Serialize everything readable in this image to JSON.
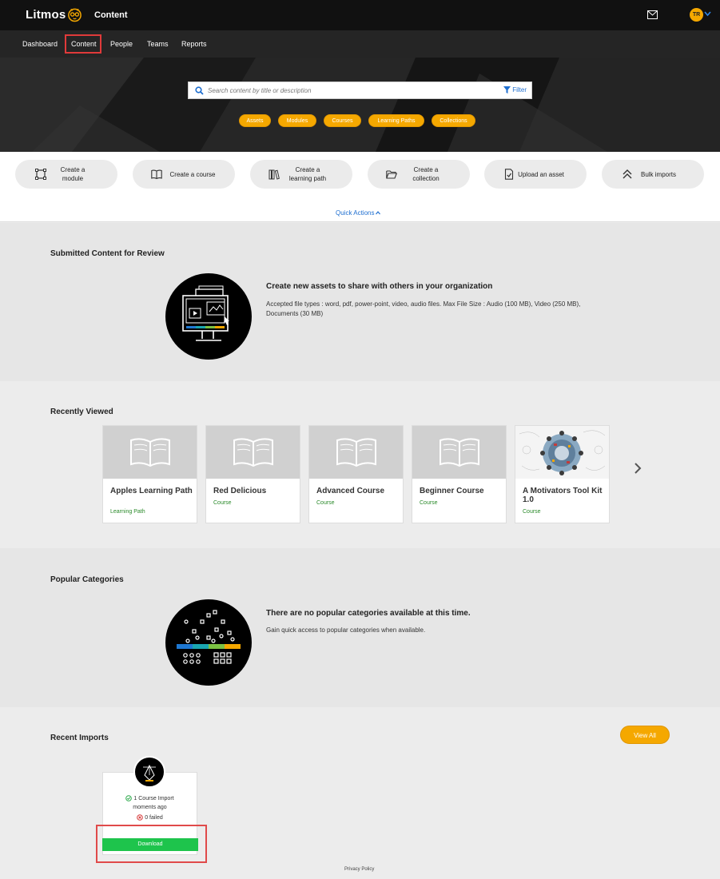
{
  "header": {
    "brand": "Litmos",
    "app_title": "Content",
    "avatar_initials": "TR",
    "accent_color": "#f5a800"
  },
  "nav": {
    "items": [
      {
        "label": "Dashboard"
      },
      {
        "label": "Content",
        "active": true
      },
      {
        "label": "People"
      },
      {
        "label": "Teams"
      },
      {
        "label": "Reports"
      }
    ]
  },
  "search": {
    "placeholder": "Search content by title or description",
    "value": "",
    "filter_label": "Filter"
  },
  "pills": [
    {
      "label": "Assets"
    },
    {
      "label": "Modules"
    },
    {
      "label": "Courses"
    },
    {
      "label": "Learning Paths"
    },
    {
      "label": "Collections"
    }
  ],
  "quick_actions": {
    "toggle_label": "Quick Actions",
    "items": [
      {
        "line1": "Create a",
        "line2": "module",
        "icon": "module-icon"
      },
      {
        "line1": "Create a course",
        "line2": "",
        "icon": "book-icon"
      },
      {
        "line1": "Create a",
        "line2": "learning path",
        "icon": "library-icon"
      },
      {
        "line1": "Create a",
        "line2": "collection",
        "icon": "folder-open-icon"
      },
      {
        "line1": "Upload an asset",
        "line2": "",
        "icon": "upload-file-icon"
      },
      {
        "line1": "Bulk imports",
        "line2": "",
        "icon": "double-chevron-up-icon"
      }
    ]
  },
  "submitted": {
    "title": "Submitted Content for Review",
    "info_title": "Create new assets to share with others in your organization",
    "info_line1": "Accepted file types : word, pdf, power-point, video, audio files. Max File Size : Audio (100 MB), Video (250 MB),",
    "info_line2": "Documents (30 MB)"
  },
  "recent": {
    "title": "Recently Viewed",
    "cards": [
      {
        "title": "Apples Learning Path",
        "type": "Learning Path",
        "thumb": "book"
      },
      {
        "title": "Red Delicious",
        "type": "Course",
        "thumb": "book"
      },
      {
        "title": "Advanced Course",
        "type": "Course",
        "thumb": "book"
      },
      {
        "title": "Beginner Course",
        "type": "Course",
        "thumb": "book"
      },
      {
        "title": "A Motivators Tool Kit 1.0",
        "type": "Course",
        "thumb": "photo"
      }
    ]
  },
  "popular": {
    "title": "Popular Categories",
    "info_title": "There are no popular categories available at this time.",
    "info_text": "Gain quick access to popular categories when available."
  },
  "imports": {
    "title": "Recent Imports",
    "view_all_label": "View All",
    "summary": "1 Course Import",
    "time": "moments ago",
    "failed": "0 failed",
    "download_label": "Download"
  },
  "footer": {
    "privacy_label": "Privacy Policy"
  }
}
